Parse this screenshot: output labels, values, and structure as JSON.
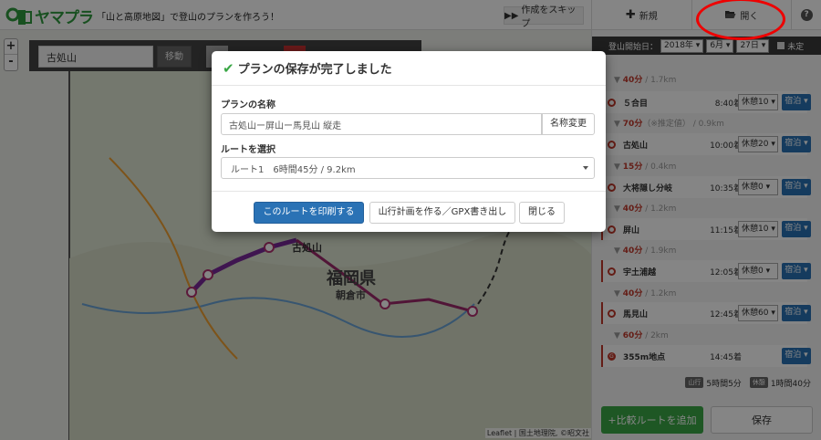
{
  "app": {
    "logo": "ヤマプラ",
    "tagline": "「山と高原地図」で登山のプランを作ろう！",
    "skip": "作成をスキップ"
  },
  "map": {
    "search_value": "古処山",
    "move_button": "移動",
    "zoom_in": "+",
    "zoom_out": "-",
    "labels": {
      "prefecture": "福岡県",
      "city": "朝倉市",
      "peak": "古処山"
    },
    "attribution": "Leaflet | 国土地理院, ©昭文社"
  },
  "sidebar": {
    "new_label": "新規",
    "open_label": "開く",
    "help_icon": "question-icon",
    "date": {
      "label": "登山開始日：",
      "year": "2018年",
      "month": "6月",
      "day": "27日",
      "undecided": "未定"
    },
    "segments": [
      {
        "time": "40分",
        "dist": " / 1.7km"
      },
      {
        "time": "70分",
        "note": "（※推定値）",
        "dist": " / 0.9km"
      },
      {
        "time": "15分",
        "dist": " / 0.4km"
      },
      {
        "time": "40分",
        "dist": " / 1.2km"
      },
      {
        "time": "40分",
        "dist": " / 1.9km"
      },
      {
        "time": "40分",
        "dist": " / 1.2km"
      },
      {
        "time": "60分",
        "dist": " / 2km"
      }
    ],
    "waypoints": [
      {
        "name": "５合目",
        "time": "8:40着",
        "rest": "休憩10",
        "stay": "宿泊"
      },
      {
        "name": "古処山",
        "time": "10:00着",
        "rest": "休憩20",
        "stay": "宿泊"
      },
      {
        "name": "大将隠し分岐",
        "time": "10:35着",
        "rest": "休憩0",
        "stay": "宿泊"
      },
      {
        "name": "屏山",
        "time": "11:15着",
        "rest": "休憩10",
        "stay": "宿泊"
      },
      {
        "name": "宇土浦越",
        "time": "12:05着",
        "rest": "休憩0",
        "stay": "宿泊"
      },
      {
        "name": "馬見山",
        "time": "12:45着",
        "rest": "休憩60",
        "stay": "宿泊"
      },
      {
        "name": "355m地点",
        "time": "14:45着",
        "rest": "",
        "stay": "宿泊"
      }
    ],
    "summary": {
      "walk_tag": "山行",
      "walk": "5時間5分",
      "rest_tag": "休憩",
      "rest": "1時間40分"
    },
    "add_route": "+比較ルートを追加",
    "save": "保存"
  },
  "modal": {
    "title": "プランの保存が完了しました",
    "name_label": "プランの名称",
    "name_value": "古処山ー屏山ー馬見山 縦走",
    "rename": "名称変更",
    "route_label": "ルートを選択",
    "route_value": "ルート1　6時間45分 / 9.2km",
    "print": "このルートを印刷する",
    "gpx": "山行計画を作る／GPX書き出し",
    "close": "閉じる"
  },
  "colors": {
    "brand": "#2e9a3e",
    "primary": "#2a72b5",
    "route": "#9b2a6a",
    "highlight": "#e00000"
  }
}
